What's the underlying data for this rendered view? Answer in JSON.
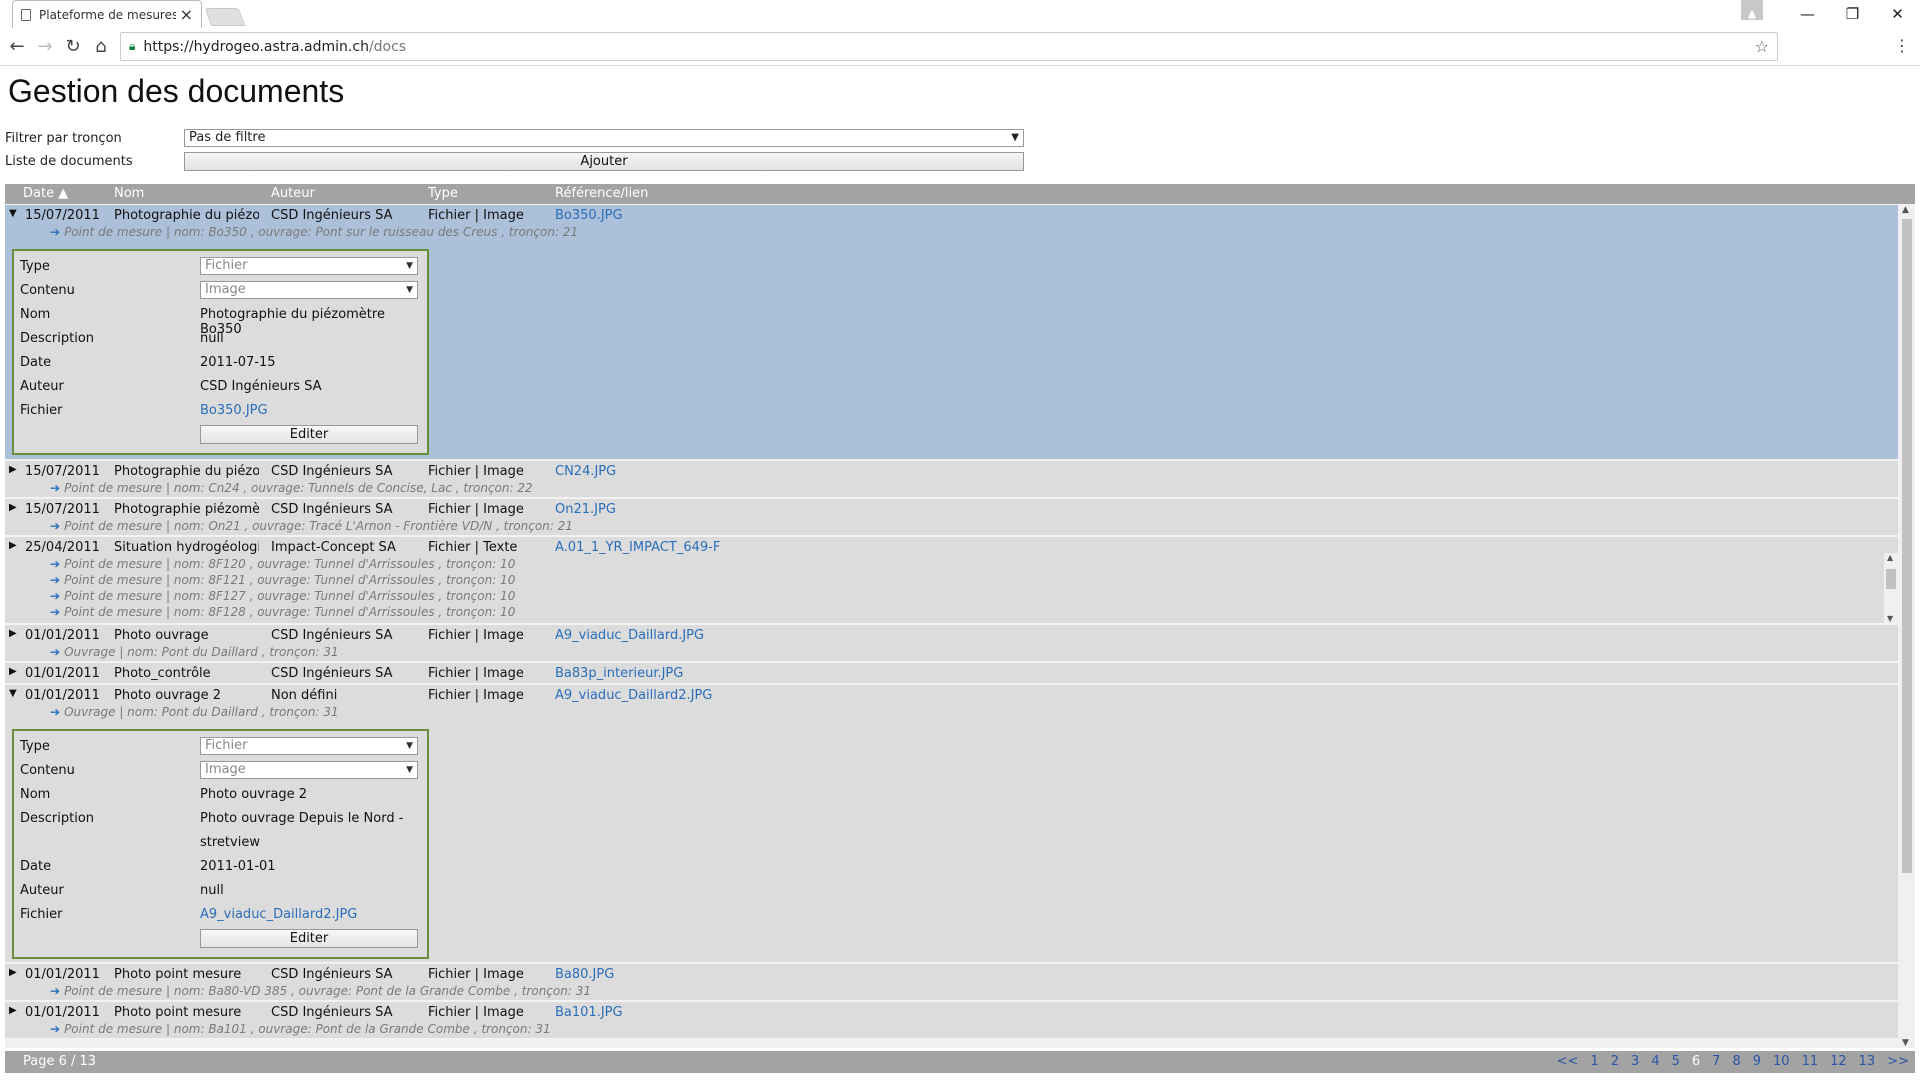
{
  "browser": {
    "tab_title": "Plateforme de mesures C",
    "url_host": "https://hydrogeo.astra.admin.ch",
    "url_path": "/docs"
  },
  "page": {
    "title": "Gestion des documents",
    "filter_label": "Filtrer par tronçon",
    "filter_value": "Pas de filtre",
    "list_label": "Liste de documents",
    "add_label": "Ajouter"
  },
  "columns": [
    "Date ▲",
    "Nom",
    "Auteur",
    "Type",
    "Référence/lien"
  ],
  "rows": [
    {
      "date": "15/07/2011",
      "nom": "Photographie du piézo...",
      "auteur": "CSD Ingénieurs SA",
      "type": "Fichier | Image",
      "ref": "Bo350.JPG",
      "links": [
        "Point de mesure | nom: Bo350 , ouvrage: Pont sur le ruisseau des Creus , tronçon: 21"
      ]
    },
    {
      "date": "15/07/2011",
      "nom": "Photographie du piézo...",
      "auteur": "CSD Ingénieurs SA",
      "type": "Fichier | Image",
      "ref": "CN24.JPG",
      "links": [
        "Point de mesure | nom: Cn24 , ouvrage: Tunnels de Concise, Lac , tronçon: 22"
      ]
    },
    {
      "date": "15/07/2011",
      "nom": "Photographie piézomèt...",
      "auteur": "CSD Ingénieurs SA",
      "type": "Fichier | Image",
      "ref": "On21.JPG",
      "links": [
        "Point de mesure | nom: On21 , ouvrage: Tracé L'Arnon - Frontière VD/N , tronçon: 21"
      ]
    },
    {
      "date": "25/04/2011",
      "nom": "Situation hydrogéologi...",
      "auteur": "Impact-Concept SA",
      "type": "Fichier | Texte",
      "ref": "A.01_1_YR_IMPACT_649-F",
      "links": [
        "Point de mesure | nom: 8F120 , ouvrage: Tunnel d'Arrissoules , tronçon: 10",
        "Point de mesure | nom: 8F121 , ouvrage: Tunnel d'Arrissoules , tronçon: 10",
        "Point de mesure | nom: 8F127 , ouvrage: Tunnel d'Arrissoules , tronçon: 10",
        "Point de mesure | nom: 8F128 , ouvrage: Tunnel d'Arrissoules , tronçon: 10"
      ]
    },
    {
      "date": "01/01/2011",
      "nom": "Photo ouvrage",
      "auteur": "CSD Ingénieurs SA",
      "type": "Fichier | Image",
      "ref": "A9_viaduc_Daillard.JPG",
      "links": [
        "Ouvrage | nom: Pont du Daillard , tronçon: 31"
      ]
    },
    {
      "date": "01/01/2011",
      "nom": "Photo_contrôle",
      "auteur": "CSD Ingénieurs SA",
      "type": "Fichier | Image",
      "ref": "Ba83p_interieur.JPG",
      "links": []
    },
    {
      "date": "01/01/2011",
      "nom": "Photo ouvrage 2",
      "auteur": "Non défini",
      "type": "Fichier | Image",
      "ref": "A9_viaduc_Daillard2.JPG",
      "links": [
        "Ouvrage | nom: Pont du Daillard , tronçon: 31"
      ]
    },
    {
      "date": "01/01/2011",
      "nom": "Photo point mesure",
      "auteur": "CSD Ingénieurs SA",
      "type": "Fichier | Image",
      "ref": "Ba80.JPG",
      "links": [
        "Point de mesure | nom: Ba80-VD 385 , ouvrage: Pont de la Grande Combe , tronçon: 31"
      ]
    },
    {
      "date": "01/01/2011",
      "nom": "Photo point mesure",
      "auteur": "CSD Ingénieurs SA",
      "type": "Fichier | Image",
      "ref": "Ba101.JPG",
      "links": [
        "Point de mesure | nom: Ba101 , ouvrage: Pont de la Grande Combe , tronçon: 31"
      ]
    }
  ],
  "detail1": {
    "labels": {
      "type": "Type",
      "contenu": "Contenu",
      "nom": "Nom",
      "description": "Description",
      "date": "Date",
      "auteur": "Auteur",
      "fichier": "Fichier"
    },
    "type": "Fichier",
    "contenu": "Image",
    "nom": "Photographie du piézomètre Bo350",
    "description": "null",
    "date": "2011-07-15",
    "auteur": "CSD Ingénieurs SA",
    "fichier": "Bo350.JPG",
    "edit": "Editer"
  },
  "detail2": {
    "type": "Fichier",
    "contenu": "Image",
    "nom": "Photo ouvrage 2",
    "description_1": "Photo ouvrage Depuis le Nord -",
    "description_2": "stretview",
    "date": "2011-01-01",
    "auteur": "null",
    "fichier": "A9_viaduc_Daillard2.JPG",
    "edit": "Editer"
  },
  "pager": {
    "label": "Page 6 / 13",
    "first": "<<",
    "pages": [
      "1",
      "2",
      "3",
      "4",
      "5",
      "6",
      "7",
      "8",
      "9",
      "10",
      "11",
      "12",
      "13"
    ],
    "last": ">>",
    "current": "6"
  }
}
